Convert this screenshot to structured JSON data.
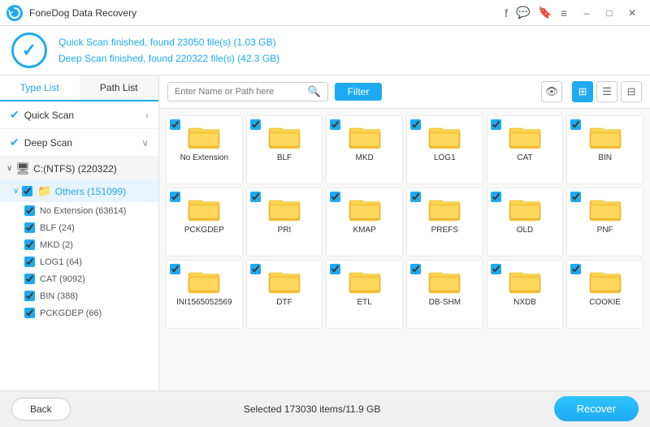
{
  "titlebar": {
    "title": "FoneDog Data Recovery",
    "icons": [
      "facebook",
      "message",
      "settings",
      "menu",
      "minimize",
      "maximize",
      "close"
    ]
  },
  "header": {
    "quick_scan_text": "Quick Scan finished, found ",
    "quick_scan_files": "23050 file(s)",
    "quick_scan_size": " (1.03 GB)",
    "deep_scan_text": "Deep Scan finished, found ",
    "deep_scan_files": "220322 file(s)",
    "deep_scan_size": " (42.3 GB)"
  },
  "sidebar": {
    "tab_type_list": "Type List",
    "tab_path_list": "Path List",
    "quick_scan_label": "Quick Scan",
    "deep_scan_label": "Deep Scan",
    "drive_label": "C:(NTFS) (220322)",
    "others_label": "Others (151099)",
    "file_types": [
      {
        "label": "No Extension (63614)",
        "checked": true
      },
      {
        "label": "BLF (24)",
        "checked": true
      },
      {
        "label": "MKD (2)",
        "checked": true
      },
      {
        "label": "LOG1 (64)",
        "checked": true
      },
      {
        "label": "CAT (9092)",
        "checked": true
      },
      {
        "label": "BIN (388)",
        "checked": true
      },
      {
        "label": "PCKGDEP (66)",
        "checked": true
      }
    ]
  },
  "toolbar": {
    "search_placeholder": "Enter Name or Path here",
    "filter_label": "Filter"
  },
  "files": [
    {
      "name": "No Extension",
      "checked": true
    },
    {
      "name": "BLF",
      "checked": true
    },
    {
      "name": "MKD",
      "checked": true
    },
    {
      "name": "LOG1",
      "checked": true
    },
    {
      "name": "CAT",
      "checked": true
    },
    {
      "name": "BIN",
      "checked": true
    },
    {
      "name": "PCKGDEP",
      "checked": true
    },
    {
      "name": "PRI",
      "checked": true
    },
    {
      "name": "KMAP",
      "checked": true
    },
    {
      "name": "PREFS",
      "checked": true
    },
    {
      "name": "OLD",
      "checked": true
    },
    {
      "name": "PNF",
      "checked": true
    },
    {
      "name": "INI1565052569",
      "checked": true
    },
    {
      "name": "DTF",
      "checked": true
    },
    {
      "name": "ETL",
      "checked": true
    },
    {
      "name": "DB-SHM",
      "checked": true
    },
    {
      "name": "NXDB",
      "checked": true
    },
    {
      "name": "COOKIE",
      "checked": true
    }
  ],
  "bottom": {
    "back_label": "Back",
    "selected_info": "Selected 173030 items/11.9 GB",
    "recover_label": "Recover"
  }
}
